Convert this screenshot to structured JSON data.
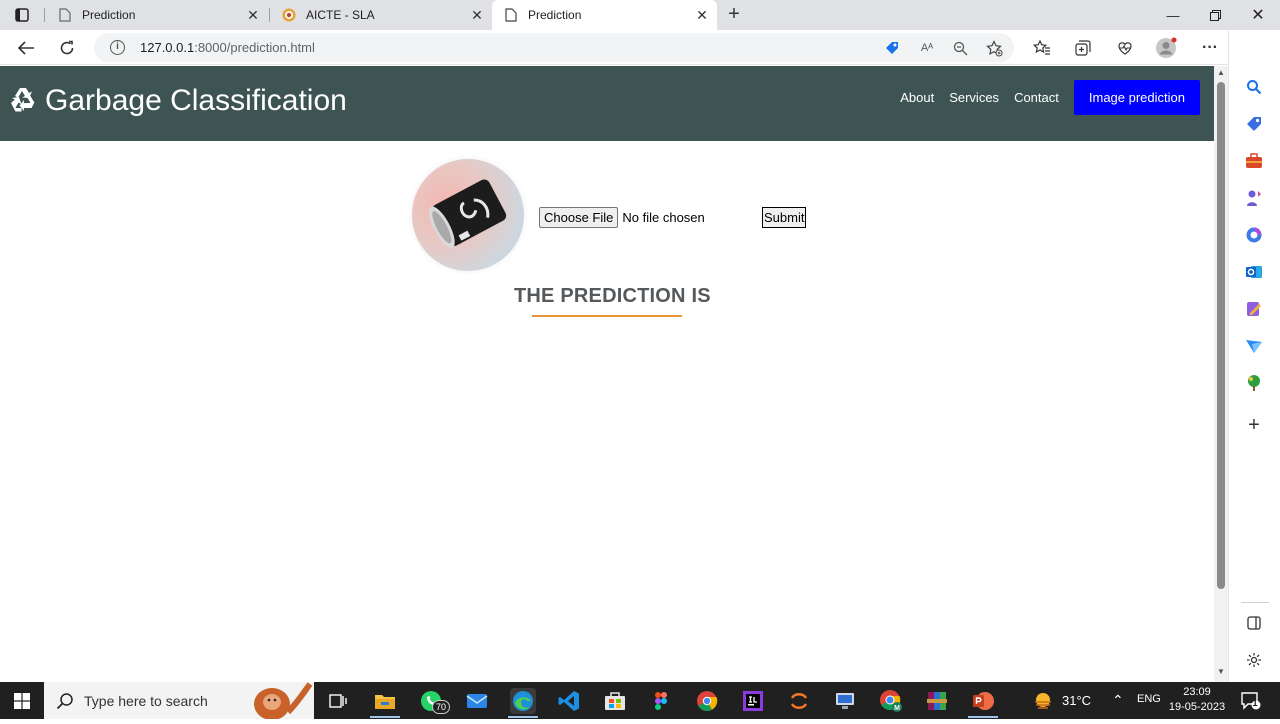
{
  "browser": {
    "tabs": [
      {
        "title": "Prediction",
        "active": false
      },
      {
        "title": "AICTE - SLA",
        "active": false
      },
      {
        "title": "Prediction",
        "active": true
      }
    ],
    "url_host": "127.0.0.1",
    "url_path": ":8000/prediction.html",
    "read_aloud_label": "Aᴬ"
  },
  "site": {
    "brand": "Garbage Classification",
    "nav": [
      "About",
      "Services",
      "Contact"
    ],
    "cta": "Image prediction"
  },
  "upload": {
    "choose_label": "Choose File",
    "status": "No file chosen",
    "submit_label": "Submit"
  },
  "prediction": {
    "heading": "THE PREDICTION IS",
    "underline_color": "#e8953a"
  },
  "taskbar": {
    "search_placeholder": "Type here to search",
    "whatsapp_badge": "70",
    "temperature": "31°C",
    "language": "ENG",
    "time": "23:09",
    "date": "19-05-2023",
    "notification_count": "1"
  },
  "colors": {
    "header_bg": "#3e5453",
    "cta_bg": "#0000ff"
  }
}
